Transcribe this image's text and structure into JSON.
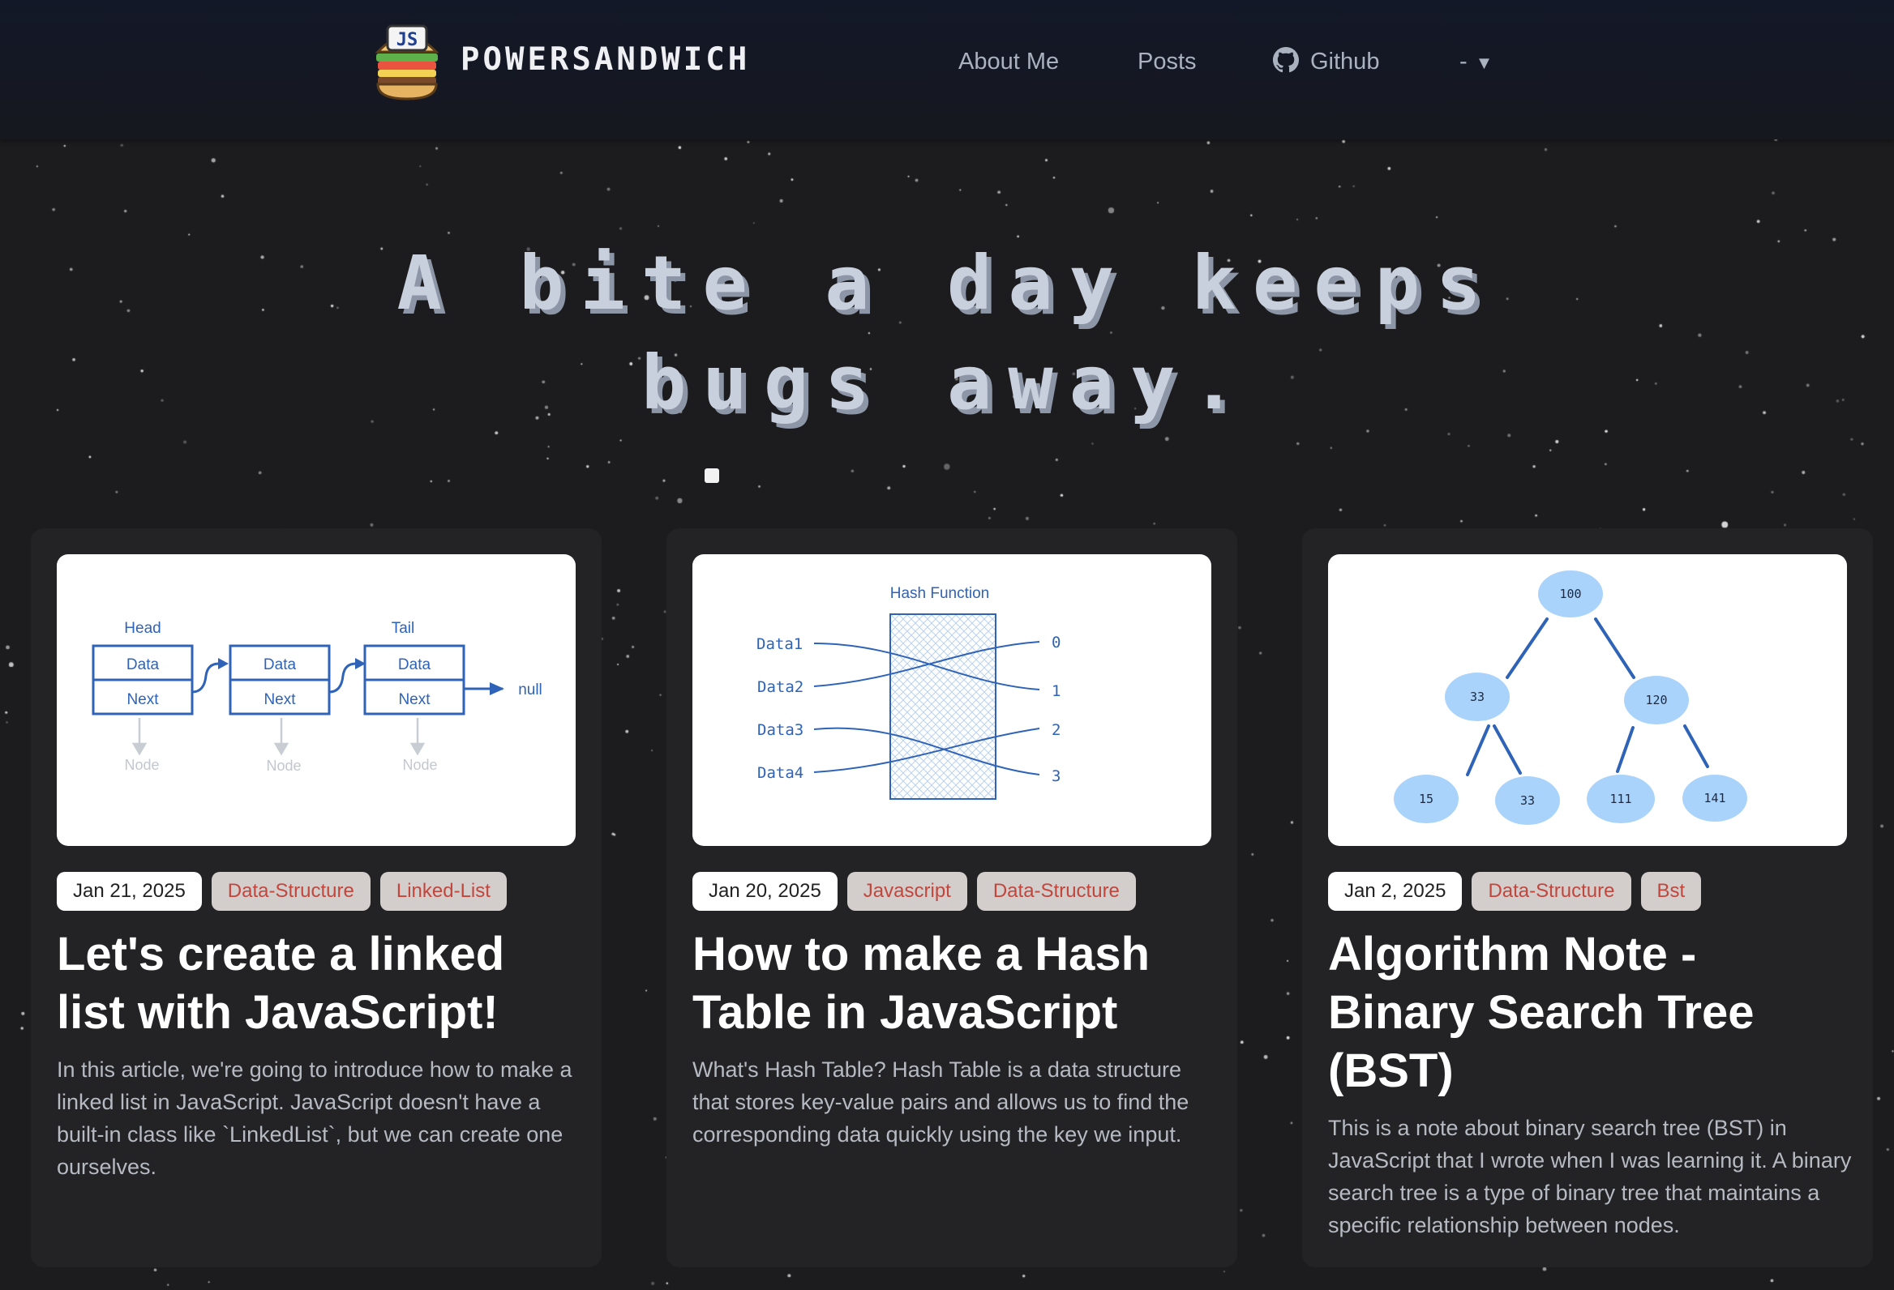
{
  "header": {
    "logo_text": "JS",
    "brand": "POWERSANDWICH",
    "nav": [
      {
        "label": "About Me"
      },
      {
        "label": "Posts"
      },
      {
        "label": "Github",
        "icon": "github-icon"
      },
      {
        "label": "-",
        "icon": "caret-down-icon"
      }
    ]
  },
  "hero": {
    "line1": "A bite a day keeps",
    "line2": "bugs away."
  },
  "posts": [
    {
      "date": "Jan 21, 2025",
      "tags": [
        "Data-Structure",
        "Linked-List"
      ],
      "title": "Let's create a linked list with JavaScript!",
      "excerpt": "In this article, we're going to introduce how to make a linked list in JavaScript. JavaScript doesn't have a built-in class like `LinkedList`, but we can create one ourselves.",
      "diagram": {
        "head": "Head",
        "tail": "Tail",
        "data": "Data",
        "next": "Next",
        "null": "null",
        "node": "Node"
      }
    },
    {
      "date": "Jan 20, 2025",
      "tags": [
        "Javascript",
        "Data-Structure"
      ],
      "title": "How to make a Hash Table in JavaScript",
      "excerpt": "What's Hash Table? Hash Table is a data structure that stores key-value pairs and allows us to find the corresponding data quickly using the key we input.",
      "diagram": {
        "function": "Hash Function",
        "keys": [
          "Data1",
          "Data2",
          "Data3",
          "Data4"
        ],
        "slots": [
          "0",
          "1",
          "2",
          "3"
        ]
      }
    },
    {
      "date": "Jan 2, 2025",
      "tags": [
        "Data-Structure",
        "Bst"
      ],
      "title": "Algorithm Note - Binary Search Tree (BST)",
      "excerpt": "This is a note about binary search tree (BST) in JavaScript that I wrote when I was learning it. A binary search tree is a type of binary tree that maintains a specific relationship between nodes.",
      "diagram": {
        "nodes": [
          "100",
          "33",
          "120",
          "15",
          "33",
          "111",
          "141"
        ]
      }
    }
  ],
  "colors": {
    "background": "#1c1c1f",
    "card": "#232326",
    "tag_text": "#c3463d",
    "tag_bg": "#d3cdcb",
    "diagram_blue": "#2f63b8",
    "bst_node": "#a9d3fb"
  }
}
